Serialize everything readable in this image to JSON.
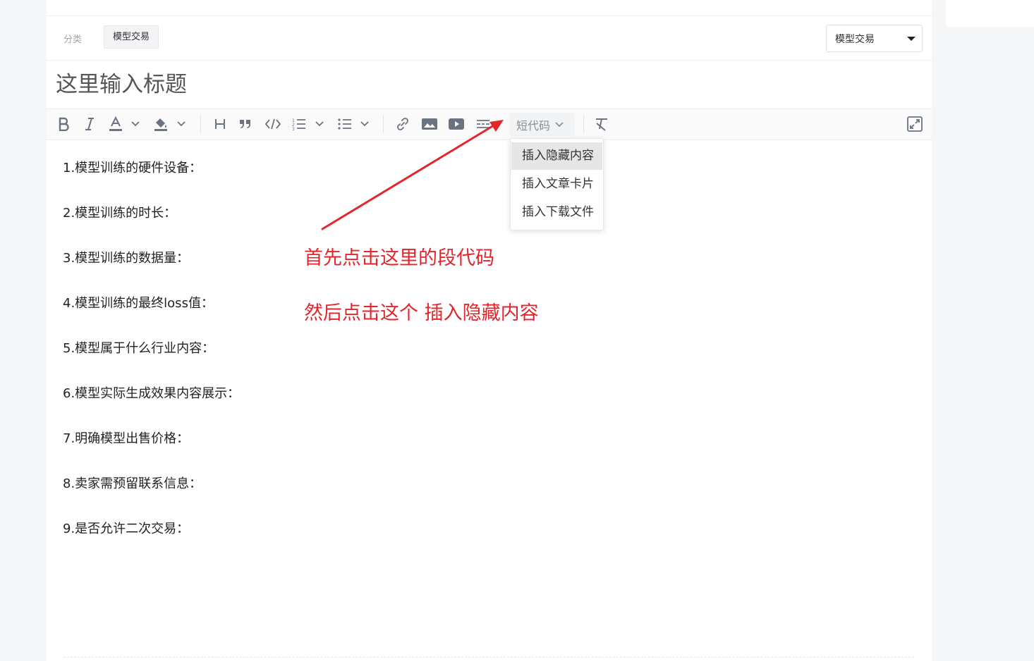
{
  "category": {
    "label": "分类",
    "tag": "模型交易",
    "select_value": "模型交易"
  },
  "title": {
    "placeholder": "这里输入标题"
  },
  "toolbar": {
    "items": [
      {
        "name": "bold-icon"
      },
      {
        "name": "italic-icon"
      },
      {
        "name": "font-color-icon"
      },
      {
        "name": "highlight-color-icon"
      },
      {
        "name": "heading-icon"
      },
      {
        "name": "quote-icon"
      },
      {
        "name": "code-icon"
      },
      {
        "name": "ordered-list-icon"
      },
      {
        "name": "bullet-list-icon"
      },
      {
        "name": "link-icon"
      },
      {
        "name": "image-icon"
      },
      {
        "name": "video-icon"
      },
      {
        "name": "horizontal-rule-icon"
      },
      {
        "name": "clear-format-icon"
      },
      {
        "name": "fullscreen-icon"
      }
    ],
    "shortcode_label": "短代码"
  },
  "shortcode_menu": {
    "items": [
      "插入隐藏内容",
      "插入文章卡片",
      "插入下载文件"
    ],
    "active_index": 0
  },
  "content": {
    "lines": [
      "1.模型训练的硬件设备：",
      "2.模型训练的时长：",
      "3.模型训练的数据量：",
      "4.模型训练的最终loss值：",
      "5.模型属于什么行业内容：",
      "6.模型实际生成效果内容展示：",
      "7.明确模型出售价格：",
      "8.卖家需预留联系信息：",
      "9.是否允许二次交易："
    ]
  },
  "annotations": {
    "step1": "首先点击这里的段代码",
    "step2": "然后点击这个 插入隐藏内容",
    "color": "#e3262c"
  }
}
